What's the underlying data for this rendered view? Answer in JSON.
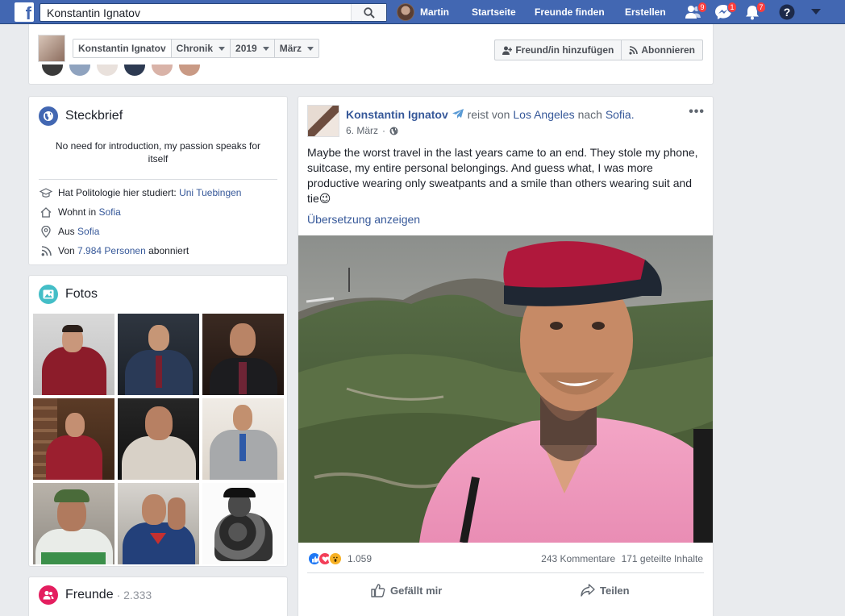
{
  "colors": {
    "brand": "#4267b2",
    "link": "#365899",
    "badge": "#fa3e3e"
  },
  "topbar": {
    "logo": "f",
    "search_value": "Konstantin Ignatov",
    "user_name": "Martin",
    "nav": [
      "Startseite",
      "Freunde finden",
      "Erstellen"
    ],
    "badges": {
      "friend_requests": "9",
      "messages": "1",
      "notifications": "7"
    },
    "icons": [
      "search-icon",
      "friend-requests-icon",
      "messenger-icon",
      "notifications-icon",
      "help-icon",
      "dropdown-icon"
    ]
  },
  "profile_header": {
    "name": "Konstantin Ignatov",
    "section": "Chronik",
    "year": "2019",
    "month": "März",
    "add_friend": "Freund/in hinzufügen",
    "follow": "Abonnieren"
  },
  "intro": {
    "title": "Steckbrief",
    "bio": "No need for introduction, my passion speaks for itself",
    "studied_prefix": "Hat Politologie hier studiert:",
    "studied_link": "Uni Tuebingen",
    "lives_prefix": "Wohnt in",
    "lives_link": "Sofia",
    "from_prefix": "Aus",
    "from_link": "Sofia",
    "followers_prefix": "Von",
    "followers_link": "7.984 Personen",
    "followers_suffix": "abonniert"
  },
  "photos": {
    "title": "Fotos",
    "count": 9
  },
  "friends": {
    "title": "Freunde",
    "count": "· 2.333"
  },
  "post": {
    "author": "Konstantin Ignatov",
    "activity": "reist von",
    "from": "Los Angeles",
    "connector": "nach",
    "to": "Sofia.",
    "date": "6. März",
    "text": "Maybe the worst travel in the last years came to an end. They stole my phone, suitcase, my entire personal belongings. And guess what, I was more productive wearing only sweatpants and a smile than others wearing suit and tie😉",
    "translate": "Übersetzung anzeigen",
    "reaction_count": "1.059",
    "comments": "243 Kommentare",
    "shares": "171 geteilte Inhalte",
    "like_label": "Gefällt mir",
    "share_label": "Teilen"
  }
}
